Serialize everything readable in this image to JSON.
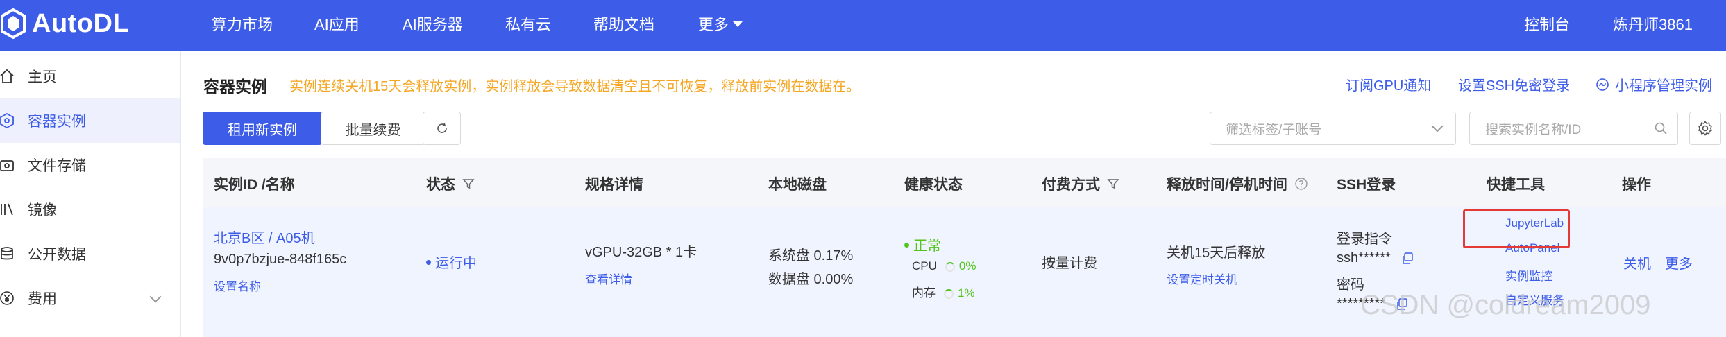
{
  "brand": {
    "name": "AutoDL"
  },
  "nav": {
    "items": [
      "算力市场",
      "AI应用",
      "AI服务器",
      "私有云",
      "帮助文档",
      "更多"
    ],
    "console": "控制台",
    "user": "炼丹师3861"
  },
  "sidebar": {
    "items": [
      {
        "label": "主页",
        "icon": "home-icon"
      },
      {
        "label": "容器实例",
        "icon": "cube-icon",
        "active": true
      },
      {
        "label": "文件存储",
        "icon": "storage-icon"
      },
      {
        "label": "镜像",
        "icon": "image-icon"
      },
      {
        "label": "公开数据",
        "icon": "database-icon"
      },
      {
        "label": "费用",
        "icon": "yen-icon"
      }
    ]
  },
  "page": {
    "title": "容器实例",
    "warning": "实例连续关机15天会释放实例，实例释放会导致数据清空且不可恢复，释放前实例在数据在。",
    "links": {
      "gpu_notice": "订阅GPU通知",
      "ssh_key": "设置SSH免密登录",
      "miniprogram": "小程序管理实例"
    },
    "toolbar": {
      "rent_button": "租用新实例",
      "renew_button": "批量续费",
      "filter_placeholder": "筛选标签/子账号",
      "search_placeholder": "搜索实例名称/ID"
    }
  },
  "table": {
    "headers": {
      "instance": "实例ID /名称",
      "status": "状态",
      "spec": "规格详情",
      "disk": "本地磁盘",
      "health": "健康状态",
      "billing": "付费方式",
      "release": "释放时间/停机时间",
      "ssh": "SSH登录",
      "tools": "快捷工具",
      "actions": "操作"
    },
    "row": {
      "region": "北京B区 / A05机",
      "instance_id": "9v0p7bzjue-848f165c",
      "set_name": "设置名称",
      "status": "运行中",
      "spec": "vGPU-32GB * 1卡",
      "spec_detail": "查看详情",
      "disk_system": "系统盘 0.17%",
      "disk_data": "数据盘 0.00%",
      "health": "正常",
      "cpu_label": "CPU",
      "cpu_value": "0%",
      "mem_label": "内存",
      "mem_value": "1%",
      "billing": "按量计费",
      "release": "关机15天后释放",
      "release_timer": "设置定时关机",
      "ssh_cmd_label": "登录指令",
      "ssh_cmd": "ssh******",
      "ssh_pwd_label": "密码",
      "ssh_pwd": "*********",
      "tools": [
        "JupyterLab",
        "AutoPanel",
        "实例监控",
        "自定义服务"
      ],
      "action_shutdown": "关机",
      "action_more": "更多"
    }
  },
  "watermark": "CSDN @coldream2009",
  "colors": {
    "brand": "#3d5ce8",
    "warning": "#f5a623",
    "success": "#52c41a",
    "highlight": "#e53935"
  }
}
